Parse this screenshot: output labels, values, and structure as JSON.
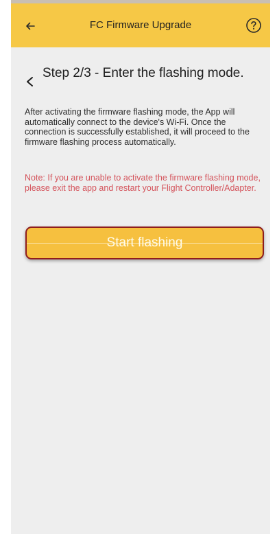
{
  "app_bar": {
    "title": "FC Firmware Upgrade",
    "back_icon": "arrow-left-icon",
    "help_icon": "question-circle-icon",
    "background": "#f6c846"
  },
  "step": {
    "title": "Step 2/3 - Enter the flashing mode.",
    "back_icon": "chevron-left-icon"
  },
  "description": "After activating the firmware flashing mode, the App will automatically connect to the device's Wi-Fi. Once the connection is successfully established, it will proceed to the firmware flashing process automatically.",
  "note": "Note: If you are unable to activate the firmware flashing mode, please exit the app and restart your Flight Controller/Adapter.",
  "start_button": {
    "label": "Start flashing",
    "color": "#f6c03f",
    "border_color": "#8f1d1d"
  },
  "colors": {
    "note_text": "#d4535b",
    "screen_background": "#eeeeee"
  }
}
